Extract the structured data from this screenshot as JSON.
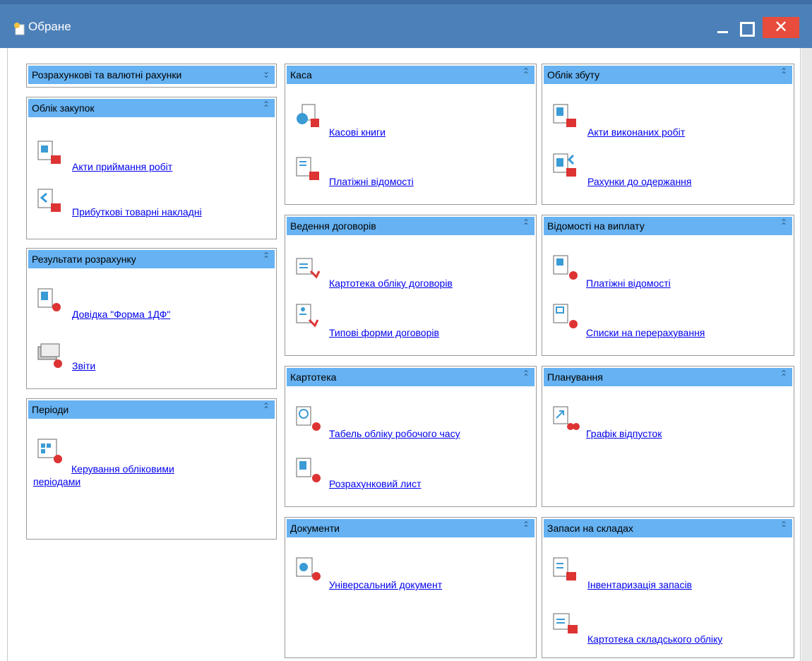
{
  "window": {
    "title": "Обране"
  },
  "panels": {
    "rozrakh": {
      "title": "Розрахункові та валютні рахунки"
    },
    "zakupok": {
      "title": "Облік закупок",
      "items": [
        "Акти приймання робіт",
        "Прибуткові товарні накладні"
      ]
    },
    "rezult": {
      "title": "Результати розрахунку",
      "items": [
        "Довідка \"Форма 1ДФ\"",
        "Звіти"
      ]
    },
    "periody": {
      "title": "Періоди",
      "items": [
        "Керування обліковими",
        "періодами"
      ]
    },
    "kasa": {
      "title": "Каса",
      "items": [
        "Касові книги",
        "Платіжні відомості"
      ]
    },
    "dohovory": {
      "title": "Ведення договорів",
      "items": [
        "Картотека обліку договорів",
        "Типові форми договорів"
      ]
    },
    "kartoteka": {
      "title": "Картотека",
      "items": [
        "Табель обліку робочого часу",
        "Розрахунковий лист"
      ]
    },
    "dokumenty": {
      "title": "Документи",
      "items": [
        "Універсальний документ"
      ]
    },
    "zbut": {
      "title": "Облік збуту",
      "items": [
        "Акти виконаних робіт",
        "Рахунки до одержання"
      ]
    },
    "vyplata": {
      "title": "Відомості на виплату",
      "items": [
        "Платіжні відомості",
        "Списки на перерахування"
      ]
    },
    "planuv": {
      "title": "Планування",
      "items": [
        "Графік відпусток"
      ]
    },
    "zapasy": {
      "title": "Запаси на складах",
      "items": [
        "Інвентаризація запасів",
        "Картотека складського обліку"
      ]
    }
  },
  "icons": {
    "collapse": "double-chevron-up-icon",
    "expand": "double-chevron-down-icon"
  },
  "colors": {
    "titlebar": "#4c80b9",
    "panel_header": "#66b2f2",
    "link": "#0000ee",
    "close": "#e74c3c"
  }
}
